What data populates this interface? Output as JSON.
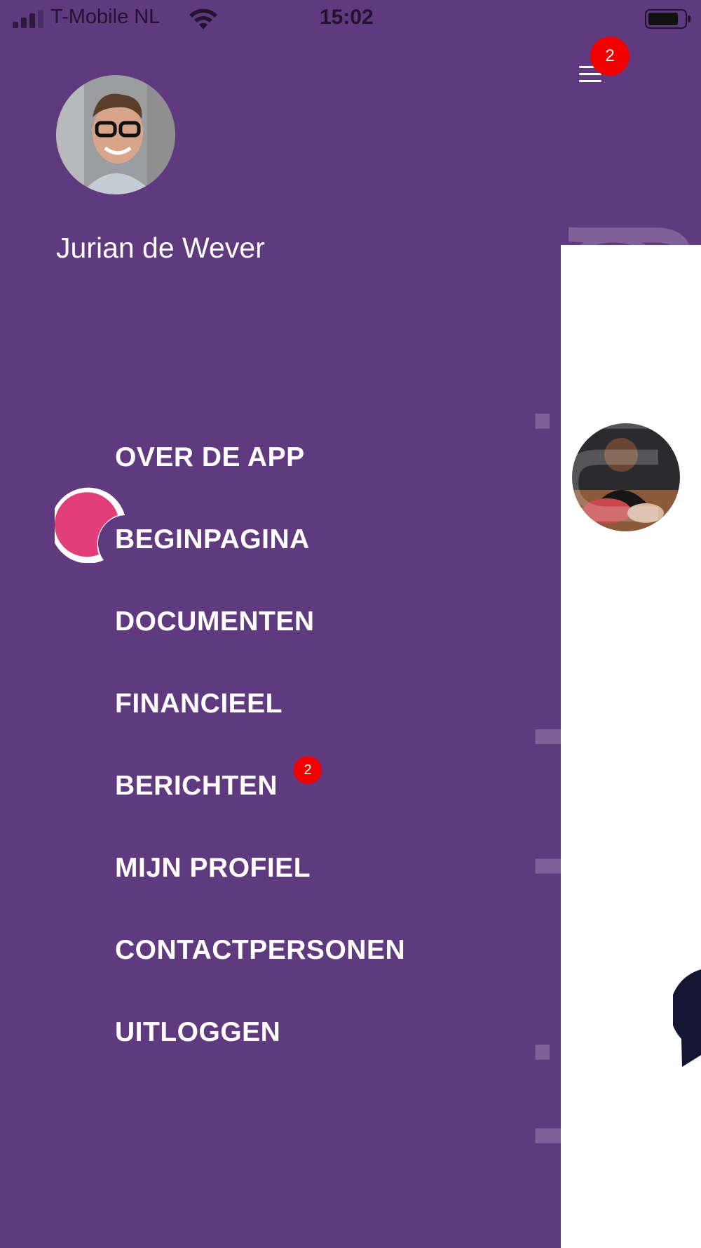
{
  "status_bar": {
    "carrier": "T-Mobile NL",
    "time": "15:02",
    "icons": [
      "signal-icon",
      "wifi-icon",
      "battery-icon"
    ]
  },
  "header": {
    "menu_icon": "hamburger-menu-icon",
    "notification_count": "2"
  },
  "profile": {
    "name": "Jurian de Wever"
  },
  "watermark": "kindplanning",
  "menu": {
    "items": [
      {
        "label": "OVER DE APP"
      },
      {
        "label": "BEGINPAGINA",
        "active": true
      },
      {
        "label": "DOCUMENTEN"
      },
      {
        "label": "FINANCIEEL"
      },
      {
        "label": "BERICHTEN",
        "badge": "2"
      },
      {
        "label": "MIJN PROFIEL"
      },
      {
        "label": "CONTACTPERSONEN"
      },
      {
        "label": "UITLOGGEN"
      }
    ]
  },
  "colors": {
    "drawer_background": "#5f3a7f",
    "badge": "#f10000",
    "active_marker": "#e23f7a",
    "content_background": "#ffffff"
  }
}
